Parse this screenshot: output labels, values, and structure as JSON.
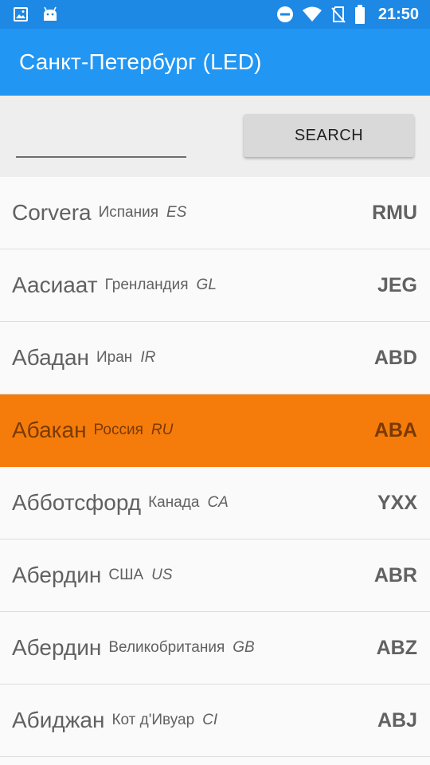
{
  "status_bar": {
    "time": "21:50",
    "icons": [
      "image-icon",
      "android-icon",
      "do-not-disturb-icon",
      "wifi-icon",
      "no-sim-icon",
      "battery-icon"
    ]
  },
  "app_bar": {
    "title": "Санкт-Петербург  (LED)"
  },
  "search": {
    "value": "",
    "placeholder": "",
    "button_label": "SEARCH"
  },
  "colors": {
    "status_bar": "#1e88e5",
    "app_bar": "#2196f3",
    "selected_row": "#f57c0b"
  },
  "results": [
    {
      "city": "Corvera",
      "country": "Испания",
      "code": "ES",
      "iata": "RMU",
      "selected": false
    },
    {
      "city": "Аасиаат",
      "country": "Гренландия",
      "code": "GL",
      "iata": "JEG",
      "selected": false
    },
    {
      "city": "Абадан",
      "country": "Иран",
      "code": "IR",
      "iata": "ABD",
      "selected": false
    },
    {
      "city": "Абакан",
      "country": "Россия",
      "code": "RU",
      "iata": "ABA",
      "selected": true
    },
    {
      "city": "Абботсфорд",
      "country": "Канада",
      "code": "CA",
      "iata": "YXX",
      "selected": false
    },
    {
      "city": "Абердин",
      "country": "США",
      "code": "US",
      "iata": "ABR",
      "selected": false
    },
    {
      "city": "Абердин",
      "country": "Великобритания",
      "code": "GB",
      "iata": "ABZ",
      "selected": false
    },
    {
      "city": "Абиджан",
      "country": "Кот д'Ивуар",
      "code": "CI",
      "iata": "ABJ",
      "selected": false
    }
  ]
}
